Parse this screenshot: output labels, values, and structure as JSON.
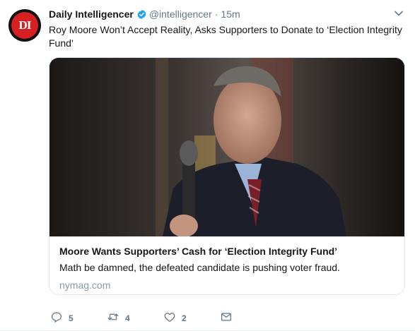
{
  "tweet": {
    "display_name": "Daily Intelligencer",
    "avatar_text": "DI",
    "handle": "@intelligencer",
    "separator": "·",
    "time": "15m",
    "text": "Roy Moore Won’t Accept Reality, Asks Supporters to Donate to ‘Election Integrity Fund’"
  },
  "card": {
    "title": "Moore Wants Supporters’ Cash for ‘Election Integrity Fund’",
    "description": "Math be damned, the defeated candidate is pushing voter fraud.",
    "domain": "nymag.com"
  },
  "actions": {
    "reply": {
      "icon": "reply-icon",
      "count": "5"
    },
    "retweet": {
      "icon": "retweet-icon",
      "count": "4"
    },
    "like": {
      "icon": "heart-icon",
      "count": "2"
    },
    "message": {
      "icon": "envelope-icon"
    }
  },
  "colors": {
    "verified_blue": "#1da1f2",
    "avatar_red": "#d62021",
    "secondary_text": "#657786"
  }
}
